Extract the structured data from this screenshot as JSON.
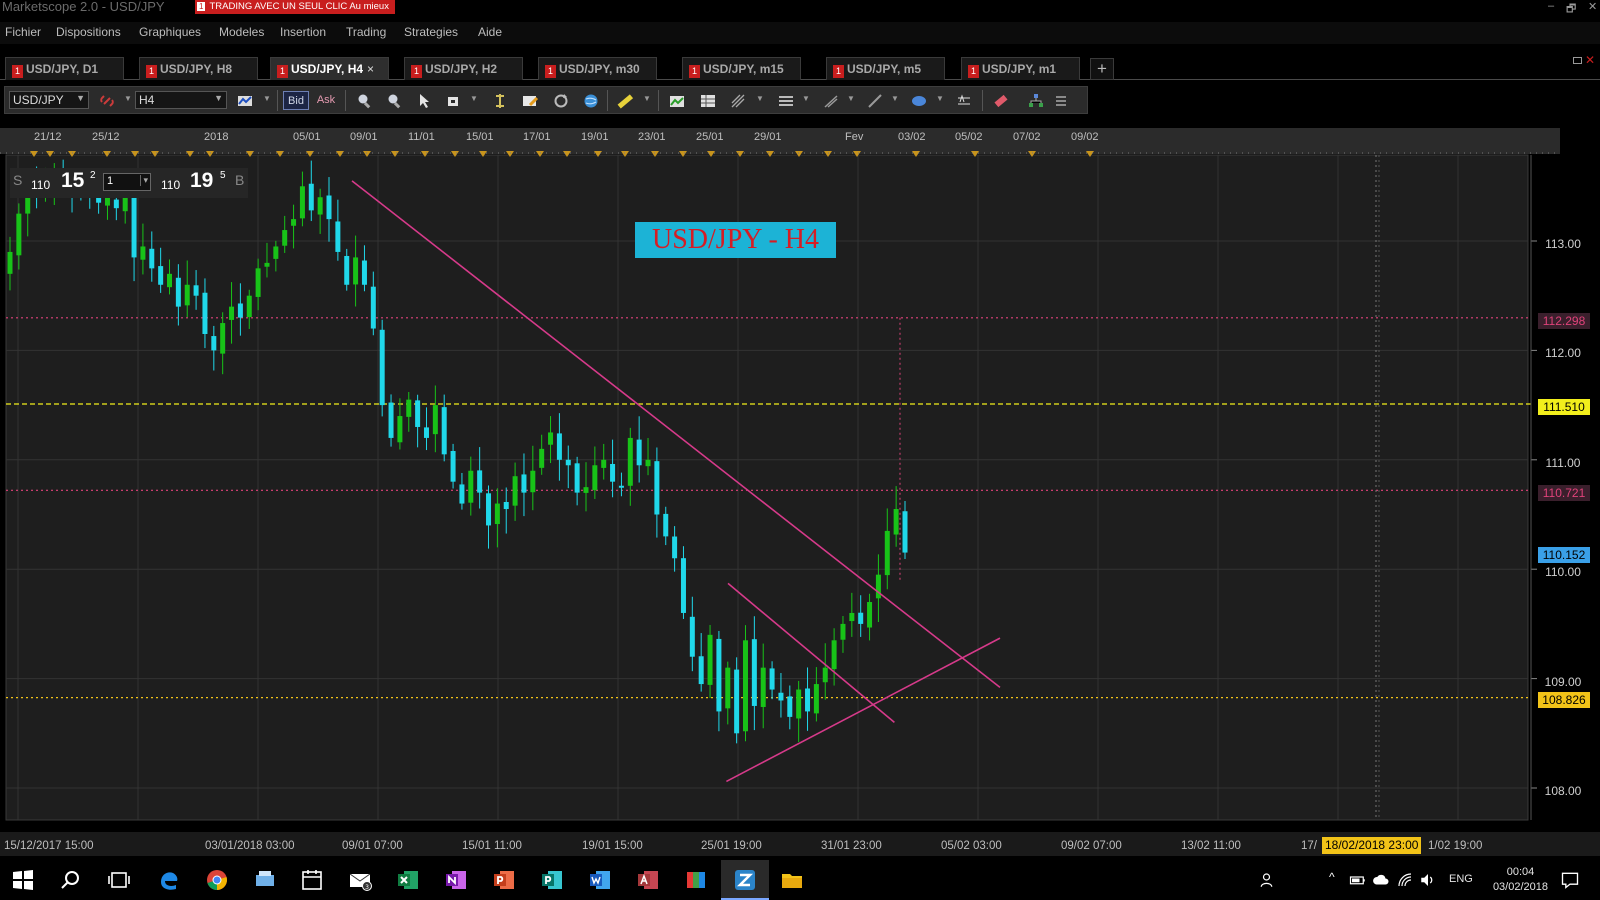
{
  "window": {
    "title": "Marketscope 2.0 - USD/JPY",
    "promo_badge": "1",
    "promo_text": "TRADING AVEC UN SEUL CLIC Au mieux",
    "controls": [
      "–",
      "🗗",
      "✕"
    ]
  },
  "menu": [
    "Fichier",
    "Dispositions",
    "Graphiques",
    "Modeles",
    "Insertion",
    "Trading",
    "Strategies",
    "Aide"
  ],
  "tabs": [
    {
      "label": "USD/JPY, D1",
      "active": false
    },
    {
      "label": "USD/JPY, H8",
      "active": false
    },
    {
      "label": "USD/JPY, H4",
      "active": true
    },
    {
      "label": "USD/JPY, H2",
      "active": false
    },
    {
      "label": "USD/JPY, m30",
      "active": false
    },
    {
      "label": "USD/JPY, m15",
      "active": false
    },
    {
      "label": "USD/JPY, m5",
      "active": false
    },
    {
      "label": "USD/JPY, m1",
      "active": false
    }
  ],
  "tab_close": "×",
  "tab_add": "+",
  "tab_icon": "1",
  "toolbar": {
    "instrument": "USD/JPY",
    "timeframe": "H4",
    "bid_label": "Bid",
    "ask_label": "Ask"
  },
  "quote": {
    "sell_label": "S",
    "sell_big_prefix": "110",
    "sell_pips": "15",
    "sell_frac": "2",
    "amount": "1",
    "buy_big_prefix": "110",
    "buy_pips": "19",
    "buy_frac": "5",
    "buy_label": "B"
  },
  "chart_label": "USD/JPY - H4",
  "chart_data": {
    "type": "candlestick",
    "instrument": "USD/JPY",
    "timeframe": "H4",
    "ylim": [
      107.8,
      114.2
    ],
    "y_ticks": [
      "113.00",
      "112.00",
      "111.00",
      "110.00",
      "109.00",
      "108.00"
    ],
    "top_dates": [
      "21/12",
      "25/12",
      "2018",
      "05/01",
      "09/01",
      "11/01",
      "15/01",
      "17/01",
      "19/01",
      "23/01",
      "25/01",
      "29/01",
      "Fev",
      "03/02",
      "05/02",
      "07/02",
      "09/02"
    ],
    "bottom_dates": [
      "15/12/2017 15:00",
      "03/01/2018 03:00",
      "09/01 07:00",
      "15/01 11:00",
      "19/01 15:00",
      "25/01 19:00",
      "31/01 23:00",
      "05/02 03:00",
      "09/02 07:00",
      "13/02 11:00",
      "17/",
      "1/02 19:00"
    ],
    "cursor_date": "18/02/2018 23:00",
    "price_levels": [
      {
        "label": "112.298",
        "value": 112.298,
        "style": "dotted",
        "color": "#e0427a"
      },
      {
        "label": "111.510",
        "value": 111.51,
        "style": "dashed",
        "color": "#f2ee1c"
      },
      {
        "label": "110.721",
        "value": 110.721,
        "style": "dotted",
        "color": "#e0427a"
      },
      {
        "label": "110.152",
        "value": 110.152,
        "style": "current",
        "color": "#3aa0e8"
      },
      {
        "label": "108.826",
        "value": 108.826,
        "style": "dotted",
        "color": "#f2c318"
      }
    ],
    "trendlines": [
      {
        "name": "main-downtrend",
        "from": [
          0.22,
          113.55
        ],
        "to": [
          0.625,
          108.92
        ]
      },
      {
        "name": "wedge-upper",
        "from": [
          0.455,
          109.87
        ],
        "to": [
          0.559,
          108.6
        ]
      },
      {
        "name": "wedge-lower",
        "from": [
          0.454,
          108.06
        ],
        "to": [
          0.625,
          109.37
        ]
      }
    ],
    "close_series": [
      112.9,
      113.25,
      113.55,
      113.4,
      113.5,
      113.62,
      113.55,
      113.48,
      113.5,
      113.42,
      113.35,
      113.4,
      113.3,
      113.45,
      112.85,
      112.95,
      112.75,
      112.6,
      112.7,
      112.4,
      112.6,
      112.5,
      112.15,
      112.0,
      112.25,
      112.4,
      112.3,
      112.5,
      112.75,
      112.8,
      112.95,
      113.1,
      113.2,
      113.5,
      113.28,
      113.4,
      113.2,
      112.9,
      112.6,
      112.85,
      112.6,
      112.2,
      111.5,
      111.2,
      111.4,
      111.55,
      111.3,
      111.2,
      111.5,
      111.05,
      110.8,
      110.6,
      110.9,
      110.7,
      110.4,
      110.6,
      110.55,
      110.85,
      110.7,
      110.9,
      111.1,
      111.25,
      111.0,
      110.95,
      110.7,
      110.75,
      110.95,
      111.0,
      110.8,
      110.75,
      111.2,
      110.95,
      111.0,
      110.5,
      110.3,
      110.1,
      109.6,
      109.2,
      108.95,
      109.4,
      108.7,
      109.1,
      108.5,
      109.35,
      108.75,
      109.1,
      108.9,
      108.8,
      108.65,
      108.9,
      108.7,
      108.95,
      109.1,
      109.35,
      109.5,
      109.6,
      109.5,
      109.7,
      109.95,
      110.35,
      110.55,
      110.152
    ]
  }
}
